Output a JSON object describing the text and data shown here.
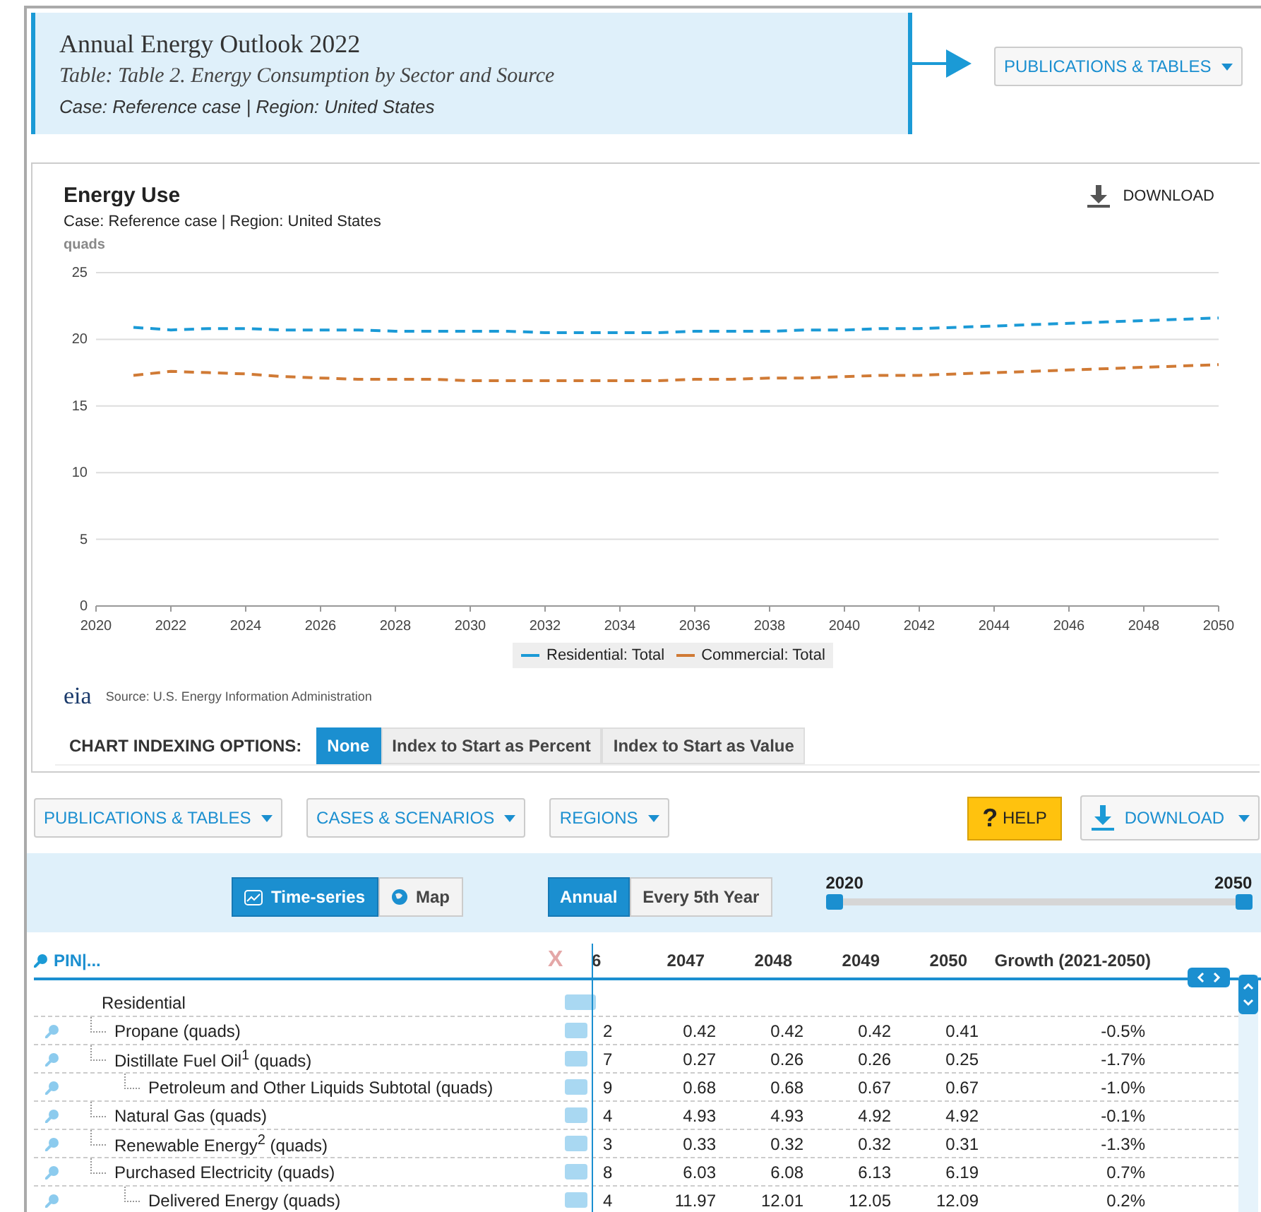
{
  "header": {
    "title": "Annual Energy Outlook 2022",
    "table": "Table: Table 2. Energy Consumption by Sector and Source",
    "case": "Case: Reference case | Region: United States",
    "menu": "PUBLICATIONS & TABLES"
  },
  "chart_panel": {
    "title": "Energy Use",
    "subtitle": "Case: Reference case | Region: United States",
    "download": "DOWNLOAD",
    "source": "Source: U.S. Energy Information Administration",
    "logo": "eia",
    "chart_data": {
      "type": "line",
      "grid": true,
      "legend": true,
      "ylabel": "quads",
      "x": [
        2021,
        2022,
        2023,
        2024,
        2025,
        2026,
        2027,
        2028,
        2029,
        2030,
        2031,
        2032,
        2033,
        2034,
        2035,
        2036,
        2037,
        2038,
        2039,
        2040,
        2041,
        2042,
        2043,
        2044,
        2045,
        2046,
        2047,
        2048,
        2049,
        2050
      ],
      "xlim": [
        2020,
        2050
      ],
      "ylim": [
        0,
        25
      ],
      "xticks": [
        2020,
        2022,
        2024,
        2026,
        2028,
        2030,
        2032,
        2034,
        2036,
        2038,
        2040,
        2042,
        2044,
        2046,
        2048,
        2050
      ],
      "yticks": [
        0,
        5,
        10,
        15,
        20,
        25
      ],
      "series": [
        {
          "name": "Residential: Total",
          "color": "#1b9ad6",
          "line_style": "dashed",
          "values": [
            20.9,
            20.7,
            20.8,
            20.8,
            20.7,
            20.7,
            20.7,
            20.6,
            20.6,
            20.6,
            20.6,
            20.5,
            20.5,
            20.5,
            20.5,
            20.6,
            20.6,
            20.6,
            20.7,
            20.7,
            20.8,
            20.8,
            20.9,
            21.0,
            21.1,
            21.2,
            21.3,
            21.4,
            21.5,
            21.6
          ]
        },
        {
          "name": "Commercial: Total",
          "color": "#d07a35",
          "line_style": "dashed",
          "values": [
            17.3,
            17.6,
            17.5,
            17.4,
            17.2,
            17.1,
            17.0,
            17.0,
            17.0,
            16.9,
            16.9,
            16.9,
            16.9,
            16.9,
            16.9,
            17.0,
            17.0,
            17.1,
            17.1,
            17.2,
            17.3,
            17.3,
            17.4,
            17.5,
            17.6,
            17.7,
            17.8,
            17.9,
            18.0,
            18.1
          ]
        }
      ]
    },
    "indexing": {
      "label": "CHART INDEXING OPTIONS:",
      "options": [
        {
          "label": "None",
          "selected": true
        },
        {
          "label": "Index to Start as Percent",
          "selected": false
        },
        {
          "label": "Index to Start as Value",
          "selected": false
        }
      ]
    }
  },
  "toolbar": {
    "menus": [
      "PUBLICATIONS & TABLES",
      "CASES & SCENARIOS",
      "REGIONS"
    ],
    "help_mark": "?",
    "help": "HELP",
    "download": "DOWNLOAD"
  },
  "controls": {
    "views": [
      {
        "label": "Time-series",
        "selected": true
      },
      {
        "label": "Map",
        "selected": false
      }
    ],
    "frequency": [
      {
        "label": "Annual",
        "selected": true
      },
      {
        "label": "Every 5th Year",
        "selected": false
      }
    ],
    "range_start": "2020",
    "range_end": "2050",
    "range": {
      "level": 1
    }
  },
  "table": {
    "pin": "PIN",
    "more": "|...",
    "clear": "X",
    "columns": [
      "6",
      "2047",
      "2048",
      "2049",
      "2050",
      "Growth (2021-2050)"
    ],
    "rows": [
      {
        "label": "Residential",
        "kind": "group",
        "cells": [],
        "children": [
          {
            "label": "Propane (quads)",
            "kind": "item",
            "cells": [
              "2",
              "0.42",
              "0.42",
              "0.42",
              "0.41",
              "-0.5%"
            ]
          },
          {
            "label": "Distillate Fuel Oil$^{1}$ (quads)",
            "kind": "item",
            "cells": [
              "7",
              "0.27",
              "0.26",
              "0.26",
              "0.25",
              "-1.7%"
            ],
            "children": [
              {
                "label": "Petroleum and Other Liquids Subtotal (quads)",
                "kind": "item",
                "cells": [
                  "9",
                  "0.68",
                  "0.68",
                  "0.67",
                  "0.67",
                  "-1.0%"
                ]
              }
            ]
          },
          {
            "label": "Natural Gas (quads)",
            "kind": "item",
            "cells": [
              "4",
              "4.93",
              "4.93",
              "4.92",
              "4.92",
              "-0.1%"
            ]
          },
          {
            "label": "Renewable Energy$^{2}$ (quads)",
            "kind": "item",
            "cells": [
              "3",
              "0.33",
              "0.32",
              "0.32",
              "0.31",
              "-1.3%"
            ]
          },
          {
            "label": "Purchased Electricity (quads)",
            "kind": "item",
            "cells": [
              "8",
              "6.03",
              "6.08",
              "6.13",
              "6.19",
              "0.7%"
            ],
            "children": [
              {
                "label": "Delivered Energy (quads)",
                "kind": "item",
                "cells": [
                  "4",
                  "11.97",
                  "12.01",
                  "12.05",
                  "12.09",
                  "0.2%"
                ]
              }
            ]
          }
        ]
      }
    ]
  }
}
